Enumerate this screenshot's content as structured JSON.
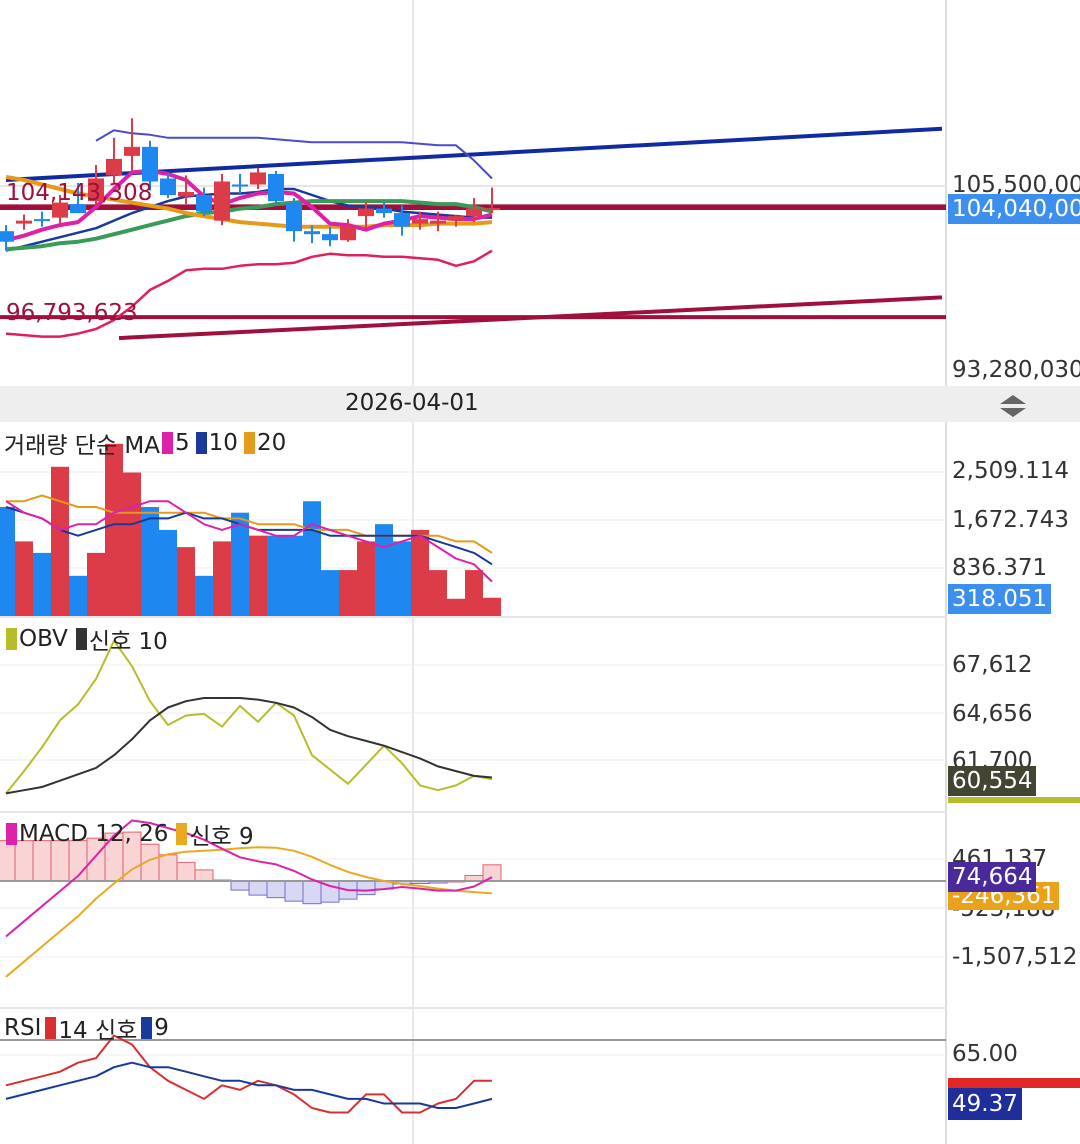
{
  "date_label": "2026-04-01",
  "colors": {
    "up": "#dc3b48",
    "down": "#1e87f0",
    "grid": "#e6e6e6",
    "ma5": "#dd22aa",
    "ma10": "#1a3a9a",
    "ma20": "#e49a1a",
    "ma_green": "#3a9a5a",
    "bollinger": "#4a4aca",
    "lower_band": "#e0205a",
    "trend_blue": "#102aa0",
    "trend_red": "#a0103c",
    "obv": "#b7bd2a",
    "obv_signal": "#333333",
    "macd": "#dd22aa",
    "macd_signal": "#e9aa20",
    "rsi": "#d83030",
    "rsi_signal": "#1a3a9a"
  },
  "price_panel": {
    "axis_labels": [
      "105,500,000",
      "93,280,030"
    ],
    "current_tag": "104,040,000",
    "annotations": [
      "104,143,308",
      "96,793,623"
    ]
  },
  "volume_panel": {
    "legend": {
      "title": "거래량 단순 MA",
      "p1": "5",
      "p2": "10",
      "p3": "20"
    },
    "axis_labels": [
      "2,509.114",
      "1,672.743",
      "836.371"
    ],
    "current_tag": "318.051"
  },
  "obv_panel": {
    "legend": {
      "name": "OBV",
      "signal": "신호 10"
    },
    "axis_labels": [
      "67,612",
      "64,656",
      "61,700"
    ],
    "current_tag": "60,554"
  },
  "macd_panel": {
    "legend": {
      "name": "MACD 12, 26",
      "signal": "신호 9"
    },
    "axis_labels": [
      "461,137",
      "-523,188",
      "-1,507,512"
    ],
    "current_tag": "74,664",
    "signal_tag": "-246,361"
  },
  "rsi_panel": {
    "legend": {
      "name": "RSI",
      "p1": "14 신호",
      "p2": "9"
    },
    "axis_labels": [
      "65.00"
    ],
    "current_tag": "49.37"
  },
  "chart_data": {
    "type": "candlestick",
    "candles": [
      [
        102500000,
        102900000,
        101200000,
        101800000
      ],
      [
        103000000,
        103600000,
        102600000,
        103200000
      ],
      [
        103300000,
        103800000,
        102800000,
        103200000
      ],
      [
        103400000,
        104900000,
        103000000,
        104400000
      ],
      [
        104300000,
        105700000,
        103700000,
        103700000
      ],
      [
        104500000,
        106900000,
        104200000,
        106000000
      ],
      [
        106200000,
        108700000,
        105700000,
        107300000
      ],
      [
        107500000,
        110000000,
        106500000,
        108100000
      ],
      [
        108100000,
        108500000,
        105200000,
        105800000
      ],
      [
        106000000,
        106300000,
        104700000,
        104900000
      ],
      [
        104800000,
        106200000,
        104300000,
        105100000
      ],
      [
        104900000,
        105400000,
        103500000,
        103800000
      ],
      [
        103200000,
        106300000,
        102900000,
        105800000
      ],
      [
        105600000,
        106300000,
        105000000,
        105500000
      ],
      [
        105600000,
        106700000,
        105300000,
        106400000
      ],
      [
        106300000,
        106500000,
        104400000,
        104500000
      ],
      [
        104400000,
        104700000,
        101800000,
        102500000
      ],
      [
        102500000,
        102900000,
        101700000,
        102300000
      ],
      [
        102300000,
        102800000,
        101500000,
        101900000
      ],
      [
        101900000,
        103300000,
        101800000,
        102800000
      ],
      [
        103500000,
        104400000,
        102700000,
        104000000
      ],
      [
        104000000,
        104400000,
        103400000,
        103700000
      ],
      [
        103700000,
        104200000,
        102200000,
        102800000
      ],
      [
        103000000,
        103800000,
        102600000,
        103300000
      ],
      [
        103000000,
        103800000,
        102500000,
        103200000
      ],
      [
        103200000,
        103600000,
        102800000,
        103500000
      ],
      [
        103500000,
        104700000,
        103100000,
        104000000
      ],
      [
        103900000,
        105400000,
        103700000,
        104040000
      ]
    ],
    "bollinger_upper": [
      null,
      null,
      null,
      null,
      null,
      108500000,
      109200000,
      109000000,
      108900000,
      108700000,
      108700000,
      108700000,
      108700000,
      108700000,
      108700000,
      108600000,
      108500000,
      108400000,
      108400000,
      108400000,
      108400000,
      108400000,
      108400000,
      108300000,
      108200000,
      108200000,
      107200000,
      106000000
    ],
    "bollinger_lower": [
      95700000,
      95600000,
      95500000,
      95500000,
      95700000,
      96000000,
      96600000,
      97500000,
      98600000,
      99200000,
      99900000,
      100000000,
      100000000,
      100200000,
      100300000,
      100300000,
      100400000,
      100800000,
      101000000,
      100900000,
      100900000,
      100800000,
      100800000,
      100700000,
      100600000,
      100200000,
      100500000,
      101200000
    ],
    "ma5": [
      101900000,
      102200000,
      102600000,
      102900000,
      103100000,
      104100000,
      105300000,
      106400000,
      106500000,
      106300000,
      105900000,
      104800000,
      104300000,
      104700000,
      105000000,
      105100000,
      105000000,
      104100000,
      103000000,
      102900000,
      102600000,
      103000000,
      103200000,
      103500000,
      103400000,
      103300000,
      103300000,
      103600000
    ],
    "ma10": [
      101200000,
      101500000,
      101800000,
      102100000,
      102400000,
      102700000,
      103200000,
      103700000,
      104100000,
      104500000,
      104800000,
      104900000,
      105000000,
      105000000,
      105100000,
      105300000,
      105300000,
      104900000,
      104500000,
      104200000,
      104100000,
      104000000,
      103800000,
      103700000,
      103600000,
      103500000,
      103400000,
      103400000
    ],
    "ma_green": [
      101300000,
      101400000,
      101500000,
      101700000,
      101800000,
      102000000,
      102300000,
      102600000,
      102900000,
      103200000,
      103500000,
      103700000,
      103800000,
      104000000,
      104100000,
      104300000,
      104400000,
      104500000,
      104500000,
      104500000,
      104500000,
      104500000,
      104500000,
      104400000,
      104300000,
      104300000,
      104100000,
      103800000
    ],
    "ma20": [
      106100000,
      105900000,
      105600000,
      105300000,
      105000000,
      104800000,
      104600000,
      104400000,
      104200000,
      104000000,
      103700000,
      103500000,
      103300000,
      103100000,
      103000000,
      102900000,
      102800000,
      102800000,
      102800000,
      102800000,
      102800000,
      102900000,
      102900000,
      102900000,
      103000000,
      103000000,
      103000000,
      103100000
    ],
    "trend_upper": {
      "from": [
        0,
        105900000
      ],
      "to": [
        52,
        109300000
      ]
    },
    "trend_lower": {
      "from": [
        6,
        95400000
      ],
      "to": [
        52,
        98100000
      ]
    },
    "hlines": [
      104143308,
      96793623
    ],
    "volume": [
      1900,
      1300,
      1100,
      2600,
      700,
      1100,
      3000,
      2500,
      1900,
      1500,
      1200,
      700,
      1300,
      1800,
      1400,
      1400,
      1400,
      2000,
      800,
      800,
      1300,
      1600,
      1300,
      1500,
      800,
      300,
      800,
      318.051
    ],
    "volume_ma5": [
      2000,
      1800,
      1700,
      1500,
      1600,
      1600,
      1800,
      1900,
      2000,
      2000,
      1800,
      1600,
      1500,
      1600,
      1500,
      1400,
      1400,
      1600,
      1500,
      1400,
      1300,
      1200,
      1300,
      1400,
      1200,
      1000,
      900,
      600
    ],
    "volume_ma10": [
      1900,
      1800,
      1700,
      1500,
      1400,
      1500,
      1600,
      1600,
      1700,
      1700,
      1800,
      1700,
      1700,
      1600,
      1500,
      1500,
      1500,
      1500,
      1400,
      1400,
      1400,
      1400,
      1400,
      1400,
      1300,
      1200,
      1100,
      900
    ],
    "volume_ma20": [
      2000,
      2000,
      2100,
      2000,
      1900,
      1900,
      1800,
      1800,
      1800,
      1800,
      1800,
      1800,
      1700,
      1700,
      1600,
      1600,
      1600,
      1500,
      1500,
      1500,
      1400,
      1400,
      1400,
      1400,
      1400,
      1300,
      1300,
      1100
    ],
    "obv": [
      59600,
      61000,
      62500,
      64200,
      65200,
      66800,
      69200,
      67600,
      65400,
      63900,
      64500,
      64600,
      63800,
      65100,
      64100,
      65300,
      64500,
      62000,
      61100,
      60200,
      61400,
      62600,
      61500,
      60100,
      59800,
      60100,
      60700,
      60500
    ],
    "obv_signal": [
      59600,
      59800,
      60000,
      60400,
      60800,
      61200,
      62000,
      63000,
      64200,
      65000,
      65400,
      65600,
      65600,
      65600,
      65500,
      65300,
      65000,
      64400,
      63600,
      63200,
      62900,
      62600,
      62200,
      61800,
      61300,
      61000,
      60700,
      60600
    ],
    "macd": [
      -1100000,
      -800000,
      -500000,
      -200000,
      100000,
      500000,
      900000,
      1200000,
      1150000,
      1050000,
      950000,
      820000,
      640000,
      470000,
      390000,
      330000,
      200000,
      30000,
      -100000,
      -180000,
      -190000,
      -160000,
      -120000,
      -150000,
      -190000,
      -190000,
      -110000,
      74664
    ],
    "macd_signal": [
      -1900000,
      -1600000,
      -1300000,
      -1000000,
      -700000,
      -350000,
      -50000,
      230000,
      420000,
      530000,
      580000,
      600000,
      620000,
      650000,
      670000,
      660000,
      600000,
      480000,
      320000,
      180000,
      80000,
      0,
      -60000,
      -100000,
      -150000,
      -190000,
      -220000,
      -246361
    ],
    "rsi": [
      55,
      56,
      57,
      58,
      60,
      61,
      66,
      64,
      59,
      56,
      54,
      52,
      55,
      54,
      56,
      55,
      53,
      50,
      49,
      49,
      53,
      53,
      49,
      49,
      51,
      52,
      56,
      56
    ],
    "rsi_signal": [
      52,
      53,
      54,
      55,
      56,
      57,
      59,
      60,
      59,
      59,
      58,
      57,
      56,
      56,
      55,
      55,
      54,
      54,
      53,
      52,
      52,
      51,
      51,
      51,
      50,
      50,
      51,
      52
    ]
  }
}
